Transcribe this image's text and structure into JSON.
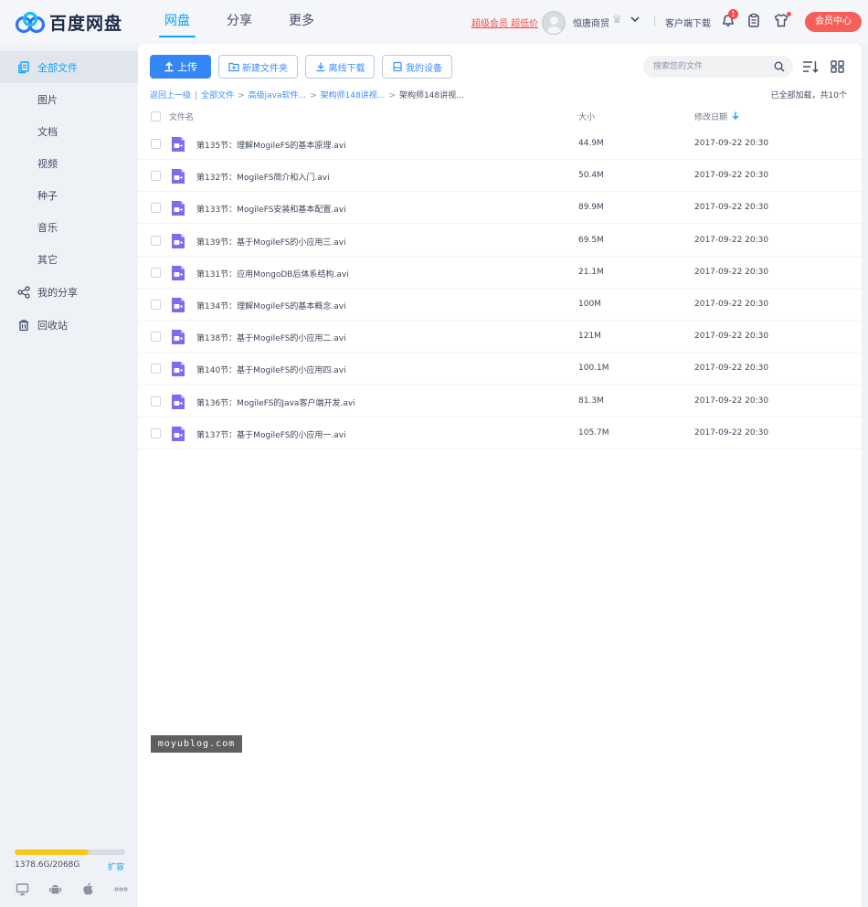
{
  "app": {
    "logo_text": "百度网盘"
  },
  "nav": {
    "items": [
      "网盘",
      "分享",
      "更多"
    ],
    "active": 0
  },
  "header": {
    "vip_link": "超级会员 超低价",
    "username": "恒唐商贸",
    "client_download": "客户端下载",
    "notification_count": "1",
    "member_center": "会员中心"
  },
  "sidebar": {
    "items": [
      {
        "label": "全部文件",
        "icon": "file-stack-icon",
        "active": true
      },
      {
        "label": "图片"
      },
      {
        "label": "文档"
      },
      {
        "label": "视频"
      },
      {
        "label": "种子"
      },
      {
        "label": "音乐"
      },
      {
        "label": "其它"
      },
      {
        "label": "我的分享",
        "icon": "share-icon"
      },
      {
        "label": "回收站",
        "icon": "trash-icon"
      }
    ],
    "quota": {
      "text": "1378.6G/2068G",
      "used_fraction": 0.667,
      "expand_label": "扩容"
    },
    "devices": [
      "desktop-icon",
      "android-icon",
      "apple-icon",
      "more-dots-icon"
    ]
  },
  "toolbar": {
    "upload": "上传",
    "new_folder": "新建文件夹",
    "offline_download": "离线下载",
    "my_devices": "我的设备",
    "search_placeholder": "搜索您的文件"
  },
  "breadcrumb": {
    "back": "返回上一级",
    "segments": [
      "全部文件",
      "高级java软件...",
      "架构师148讲视..."
    ],
    "current": "架构师148讲视..."
  },
  "load_status": "已全部加载，共10个",
  "table": {
    "headers": {
      "name": "文件名",
      "size": "大小",
      "date": "修改日期"
    },
    "rows": [
      {
        "name": "第135节：理解MogileFS的基本原理.avi",
        "size": "44.9M",
        "date": "2017-09-22 20:30"
      },
      {
        "name": "第132节：MogileFS简介和入门.avi",
        "size": "50.4M",
        "date": "2017-09-22 20:30"
      },
      {
        "name": "第133节：MogileFS安装和基本配置.avi",
        "size": "89.9M",
        "date": "2017-09-22 20:30"
      },
      {
        "name": "第139节：基于MogileFS的小应用三.avi",
        "size": "69.5M",
        "date": "2017-09-22 20:30"
      },
      {
        "name": "第131节：应用MongoDB后体系结构.avi",
        "size": "21.1M",
        "date": "2017-09-22 20:30"
      },
      {
        "name": "第134节：理解MogileFS的基本概念.avi",
        "size": "100M",
        "date": "2017-09-22 20:30"
      },
      {
        "name": "第138节：基于MogileFS的小应用二.avi",
        "size": "121M",
        "date": "2017-09-22 20:30"
      },
      {
        "name": "第140节：基于MogileFS的小应用四.avi",
        "size": "100.1M",
        "date": "2017-09-22 20:30"
      },
      {
        "name": "第136节：MogileFS的Java客户端开发.avi",
        "size": "81.3M",
        "date": "2017-09-22 20:30"
      },
      {
        "name": "第137节：基于MogileFS的小应用一.avi",
        "size": "105.7M",
        "date": "2017-09-22 20:30"
      }
    ]
  },
  "watermark": "moyublog.com",
  "colors": {
    "accent": "#06a7ff",
    "primary_button": "#3587f5",
    "member_button": "#f55f5a",
    "quota_fill": "#f7c81a",
    "video_icon": "#7b6cf0"
  }
}
